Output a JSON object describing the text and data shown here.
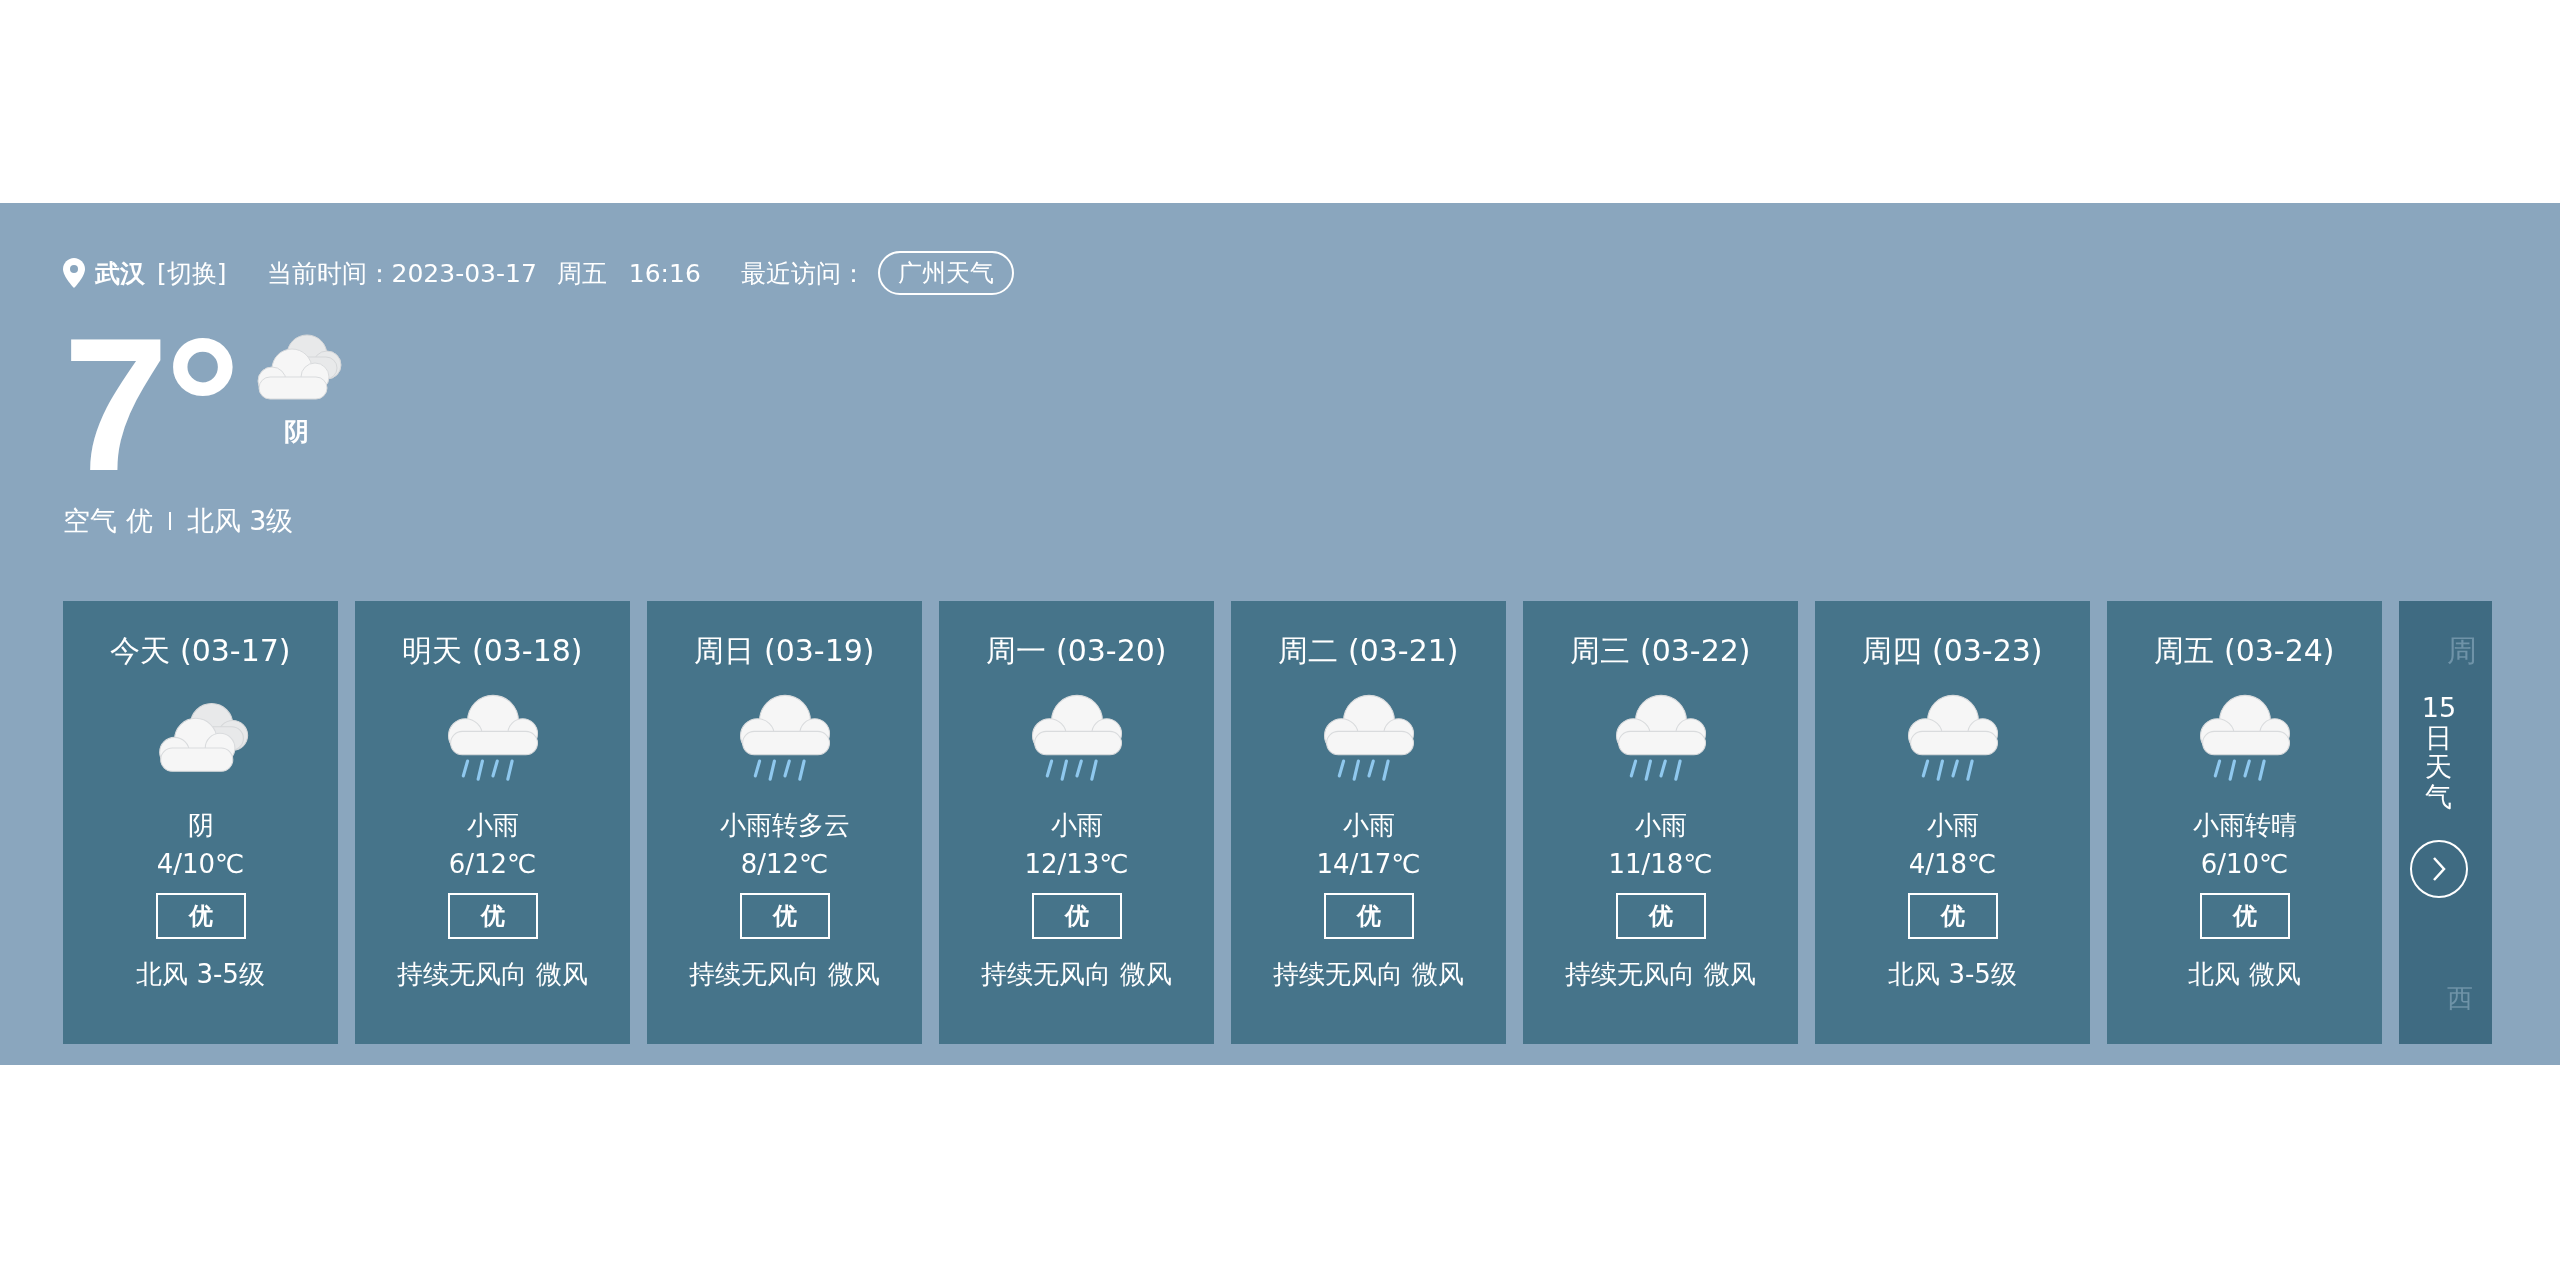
{
  "header": {
    "city": "武汉",
    "switch_link": "[切换]",
    "time_label": "当前时间：",
    "date": "2023-03-17",
    "weekday": "周五",
    "time": "16:16",
    "recent_label": "最近访问：",
    "recent_cities": [
      "广州天气"
    ]
  },
  "current": {
    "temperature": "7°",
    "kind": "cloudy",
    "condition": "阴",
    "air": "空气 优",
    "wind": "北风 3级"
  },
  "forecast": [
    {
      "title": "今天 (03-17)",
      "kind": "cloudy",
      "condition": "阴",
      "temp": "4/10℃",
      "aqi": "优",
      "wind": "北风 3-5级"
    },
    {
      "title": "明天 (03-18)",
      "kind": "rain",
      "condition": "小雨",
      "temp": "6/12℃",
      "aqi": "优",
      "wind": "持续无风向 微风"
    },
    {
      "title": "周日 (03-19)",
      "kind": "rain",
      "condition": "小雨转多云",
      "temp": "8/12℃",
      "aqi": "优",
      "wind": "持续无风向 微风"
    },
    {
      "title": "周一 (03-20)",
      "kind": "rain",
      "condition": "小雨",
      "temp": "12/13℃",
      "aqi": "优",
      "wind": "持续无风向 微风"
    },
    {
      "title": "周二 (03-21)",
      "kind": "rain",
      "condition": "小雨",
      "temp": "14/17℃",
      "aqi": "优",
      "wind": "持续无风向 微风"
    },
    {
      "title": "周三 (03-22)",
      "kind": "rain",
      "condition": "小雨",
      "temp": "11/18℃",
      "aqi": "优",
      "wind": "持续无风向 微风"
    },
    {
      "title": "周四 (03-23)",
      "kind": "rain",
      "condition": "小雨",
      "temp": "4/18℃",
      "aqi": "优",
      "wind": "北风 3-5级"
    },
    {
      "title": "周五 (03-24)",
      "kind": "rain",
      "condition": "小雨转晴",
      "temp": "6/10℃",
      "aqi": "优",
      "wind": "北风 微风"
    }
  ],
  "partial_day": {
    "title": "周",
    "wind": "西"
  },
  "more": {
    "label": "15日天气"
  }
}
